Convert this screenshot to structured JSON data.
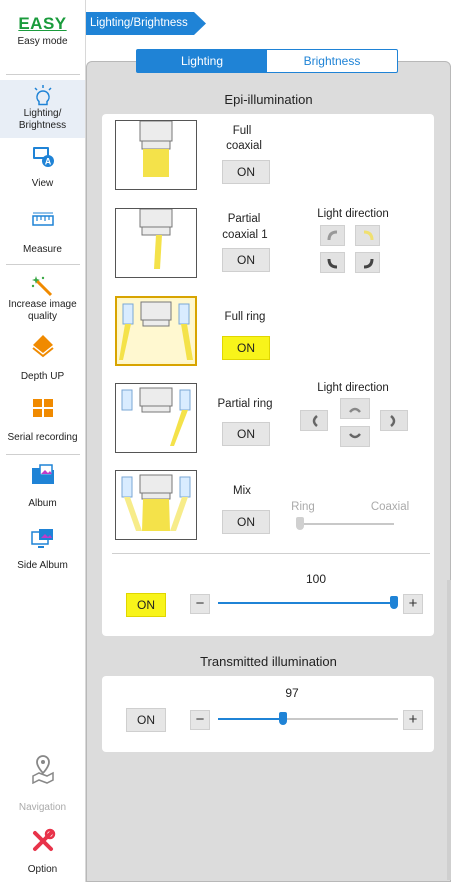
{
  "sidebar": {
    "easy_title": "EASY",
    "easy_label": "Easy mode",
    "items": [
      {
        "label1": "Lighting/",
        "label2": "Brightness"
      },
      {
        "label": "View"
      },
      {
        "label": "Measure"
      },
      {
        "label1": "Increase image",
        "label2": "quality"
      },
      {
        "label": "Depth UP"
      },
      {
        "label": "Serial recording"
      },
      {
        "label": "Album"
      },
      {
        "label": "Side Album"
      }
    ],
    "navigation_label": "Navigation",
    "option_label": "Option"
  },
  "breadcrumb": "Lighting/Brightness",
  "tabs": [
    "Lighting",
    "Brightness"
  ],
  "epi": {
    "title": "Epi-illumination",
    "full_coaxial": {
      "line1": "Full",
      "line2": "coaxial",
      "button": "ON"
    },
    "partial_coaxial": {
      "line1": "Partial",
      "line2": "coaxial 1",
      "button": "ON",
      "direction_label": "Light direction"
    },
    "full_ring": {
      "label": "Full ring",
      "button": "ON"
    },
    "partial_ring": {
      "label": "Partial ring",
      "button": "ON",
      "direction_label": "Light direction"
    },
    "mix": {
      "label": "Mix",
      "button": "ON",
      "ring_label": "Ring",
      "coaxial_label": "Coaxial",
      "level": 0
    },
    "master": {
      "button": "ON",
      "value": "100",
      "level": 100
    }
  },
  "transmitted": {
    "title": "Transmitted illumination",
    "button": "ON",
    "value": "97",
    "level": 0.36
  },
  "colors": {
    "accent": "#1f83d6",
    "on_yellow": "#f8f41a",
    "easy_green": "#1a9b3c"
  }
}
